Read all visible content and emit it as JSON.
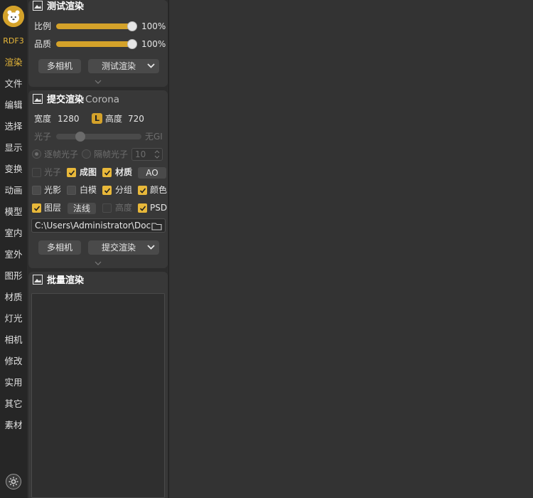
{
  "sidebar": {
    "brand": "RDF3",
    "items": [
      {
        "label": "渲染",
        "active": true
      },
      {
        "label": "文件"
      },
      {
        "label": "编辑"
      },
      {
        "label": "选择"
      },
      {
        "label": "显示"
      },
      {
        "label": "变换"
      },
      {
        "label": "动画"
      },
      {
        "label": "模型"
      },
      {
        "label": "室内"
      },
      {
        "label": "室外"
      },
      {
        "label": "图形"
      },
      {
        "label": "材质"
      },
      {
        "label": "灯光"
      },
      {
        "label": "相机"
      },
      {
        "label": "修改"
      },
      {
        "label": "实用"
      },
      {
        "label": "其它"
      },
      {
        "label": "素材"
      }
    ],
    "settings_icon": "gear-icon"
  },
  "test_render": {
    "title": "测试渲染",
    "ratio_label": "比例",
    "ratio_value": "100%",
    "ratio_level": 1.0,
    "quality_label": "品质",
    "quality_value": "100%",
    "quality_level": 1.0,
    "multi_camera": "多相机",
    "render_button": "测试渲染"
  },
  "submit_render": {
    "title": "提交渲染",
    "engine": "Corona",
    "width_label": "宽度",
    "width_value": "1280",
    "lock_badge": "L",
    "height_label": "高度",
    "height_value": "720",
    "photon_label": "光子",
    "no_gi_label": "无GI",
    "photon_level": 0.28,
    "per_frame_photon": "逐帧光子",
    "interval_photon": "隔帧光子",
    "interval_value": "10",
    "checks": {
      "photon": "光子",
      "final": "成图",
      "material": "材质",
      "ao": "AO",
      "shadow": "光影",
      "white_model": "白模",
      "group": "分组",
      "color": "颜色",
      "layer": "图层",
      "normal": "法线",
      "height": "高度",
      "psd": "PSD"
    },
    "output_path": "C:\\Users\\Administrator\\Doc",
    "multi_camera": "多相机",
    "submit_button": "提交渲染"
  },
  "batch_render": {
    "title": "批量渲染"
  },
  "colors": {
    "accent": "#d4a22a",
    "background": "#333333",
    "panel": "#383838"
  }
}
